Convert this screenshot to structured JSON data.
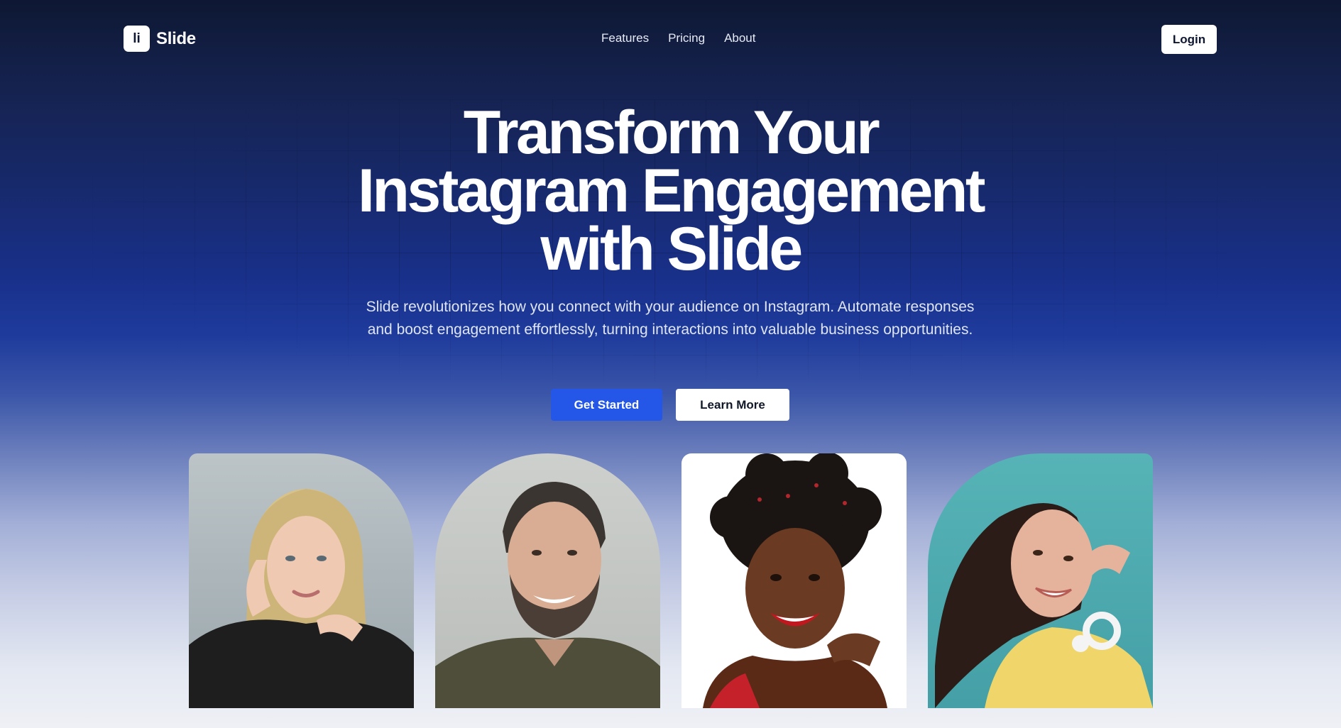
{
  "brand": {
    "mark": "li",
    "name": "Slide"
  },
  "nav": {
    "links": [
      "Features",
      "Pricing",
      "About"
    ],
    "login_label": "Login"
  },
  "hero": {
    "title_lines": [
      "Transform Your",
      "Instagram Engagement",
      "with Slide"
    ],
    "subtitle": "Slide revolutionizes how you connect with your audience on Instagram. Automate responses and boost engagement effortlessly, turning interactions into valuable business opportunities.",
    "primary_cta": "Get Started",
    "secondary_cta": "Learn More"
  },
  "colors": {
    "accent": "#2456e8",
    "background_top": "#0e1833",
    "background_mid": "#1e3b9c",
    "background_bottom": "#eef0f5"
  }
}
